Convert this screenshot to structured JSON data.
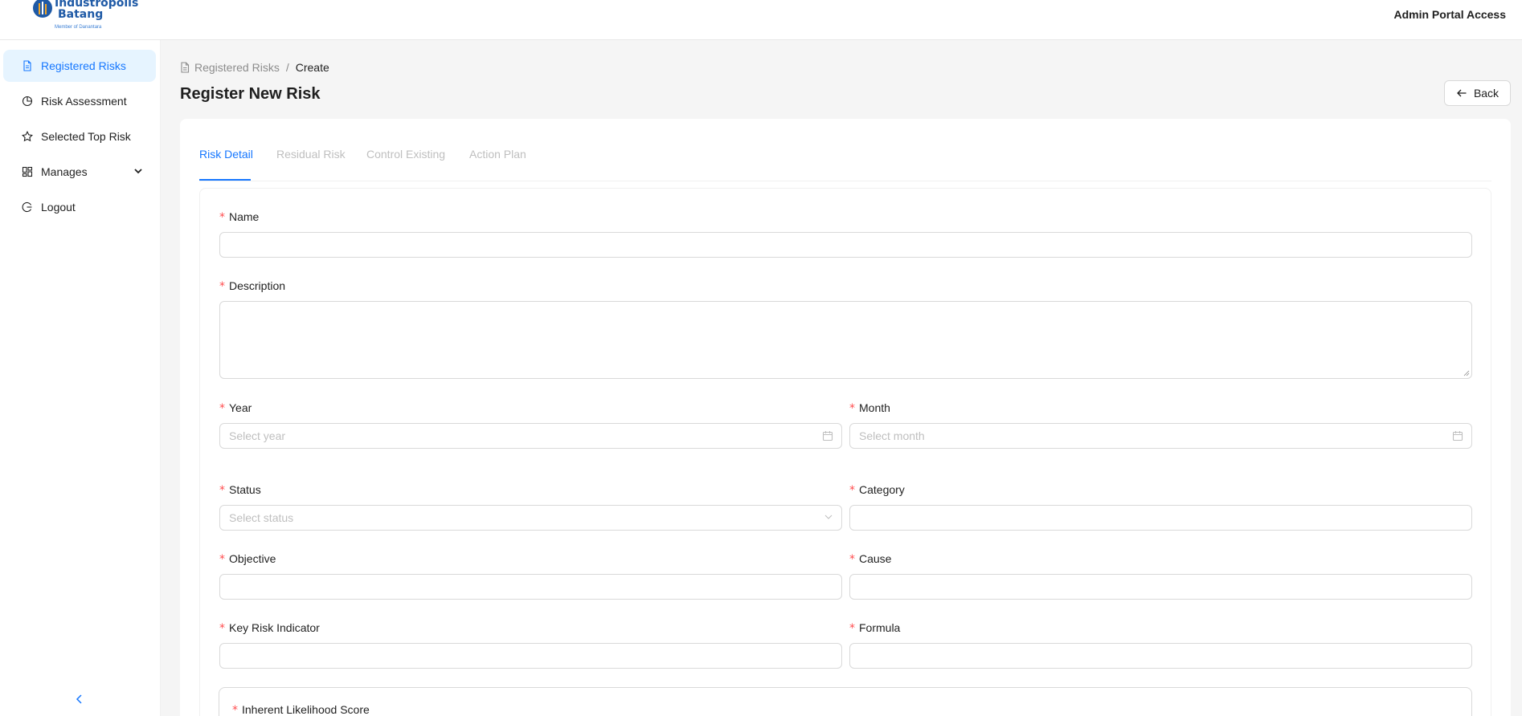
{
  "brand": {
    "name_line1": "Industropolis",
    "name_line2": "Batang",
    "sub": "Member of Danantara"
  },
  "header": {
    "portal_label": "Admin Portal Access"
  },
  "sidebar": {
    "items": [
      {
        "label": "Registered Risks",
        "icon": "file-icon",
        "active": true
      },
      {
        "label": "Risk Assessment",
        "icon": "pie-chart-icon"
      },
      {
        "label": "Selected Top Risk",
        "icon": "star-icon"
      },
      {
        "label": "Manages",
        "icon": "dashboard-icon"
      },
      {
        "label": "Logout",
        "icon": "logout-icon"
      }
    ]
  },
  "breadcrumb": {
    "parent": "Registered Risks",
    "separator": "/",
    "current": "Create"
  },
  "page": {
    "title": "Register New Risk",
    "back_label": "Back"
  },
  "tabs": [
    {
      "label": "Risk Detail",
      "active": true
    },
    {
      "label": "Residual Risk"
    },
    {
      "label": "Control Existing"
    },
    {
      "label": "Action Plan"
    }
  ],
  "form": {
    "required_mark": "*",
    "name": {
      "label": "Name",
      "value": ""
    },
    "description": {
      "label": "Description",
      "value": ""
    },
    "year": {
      "label": "Year",
      "placeholder": "Select year"
    },
    "month": {
      "label": "Month",
      "placeholder": "Select month"
    },
    "status": {
      "label": "Status",
      "placeholder": "Select status"
    },
    "category": {
      "label": "Category",
      "value": ""
    },
    "objective": {
      "label": "Objective",
      "value": ""
    },
    "cause": {
      "label": "Cause",
      "value": ""
    },
    "kri": {
      "label": "Key Risk Indicator",
      "value": ""
    },
    "formula": {
      "label": "Formula",
      "value": ""
    },
    "inherent_likelihood": {
      "label": "Inherent Likelihood Score"
    }
  },
  "colors": {
    "primary": "#1677ff",
    "required": "#ff4d4f",
    "brand": "#1f5aa6"
  }
}
